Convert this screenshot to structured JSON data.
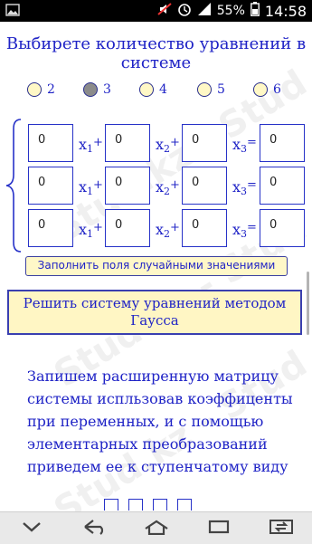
{
  "status_bar": {
    "battery_text": "55%",
    "time": "14:58",
    "icons": [
      "gallery-icon",
      "mute-icon",
      "alarm-icon",
      "signal-icon",
      "battery-icon"
    ]
  },
  "title": "Выбирете количество уравнений в системе",
  "equation_count": {
    "selected": "3",
    "options": [
      "2",
      "3",
      "4",
      "5",
      "6"
    ]
  },
  "equations": [
    {
      "coefficients": [
        "0",
        "0",
        "0"
      ],
      "result": "0"
    },
    {
      "coefficients": [
        "0",
        "0",
        "0"
      ],
      "result": "0"
    },
    {
      "coefficients": [
        "0",
        "0",
        "0"
      ],
      "result": "0"
    }
  ],
  "variables": {
    "x": "x",
    "sub1": "1",
    "sub2": "2",
    "sub3": "3",
    "plus": "+",
    "equals": "="
  },
  "fill_random_button": "Заполнить поля случайными значениями",
  "solve_button": "Решить систему уравнений методом Гаусса",
  "description": "Запишем расширенную матрицу системы испльзовав коэффиценты при переменных, и с помощью элементарных преобразований приведем ее к ступенчатому виду",
  "watermark": "Stud.kz - Stud",
  "colors": {
    "primary_text": "#1f23c6",
    "button_bg": "#fff6c4",
    "radio_bg": "#fff8c6",
    "radio_selected": "#8b8b8b"
  }
}
